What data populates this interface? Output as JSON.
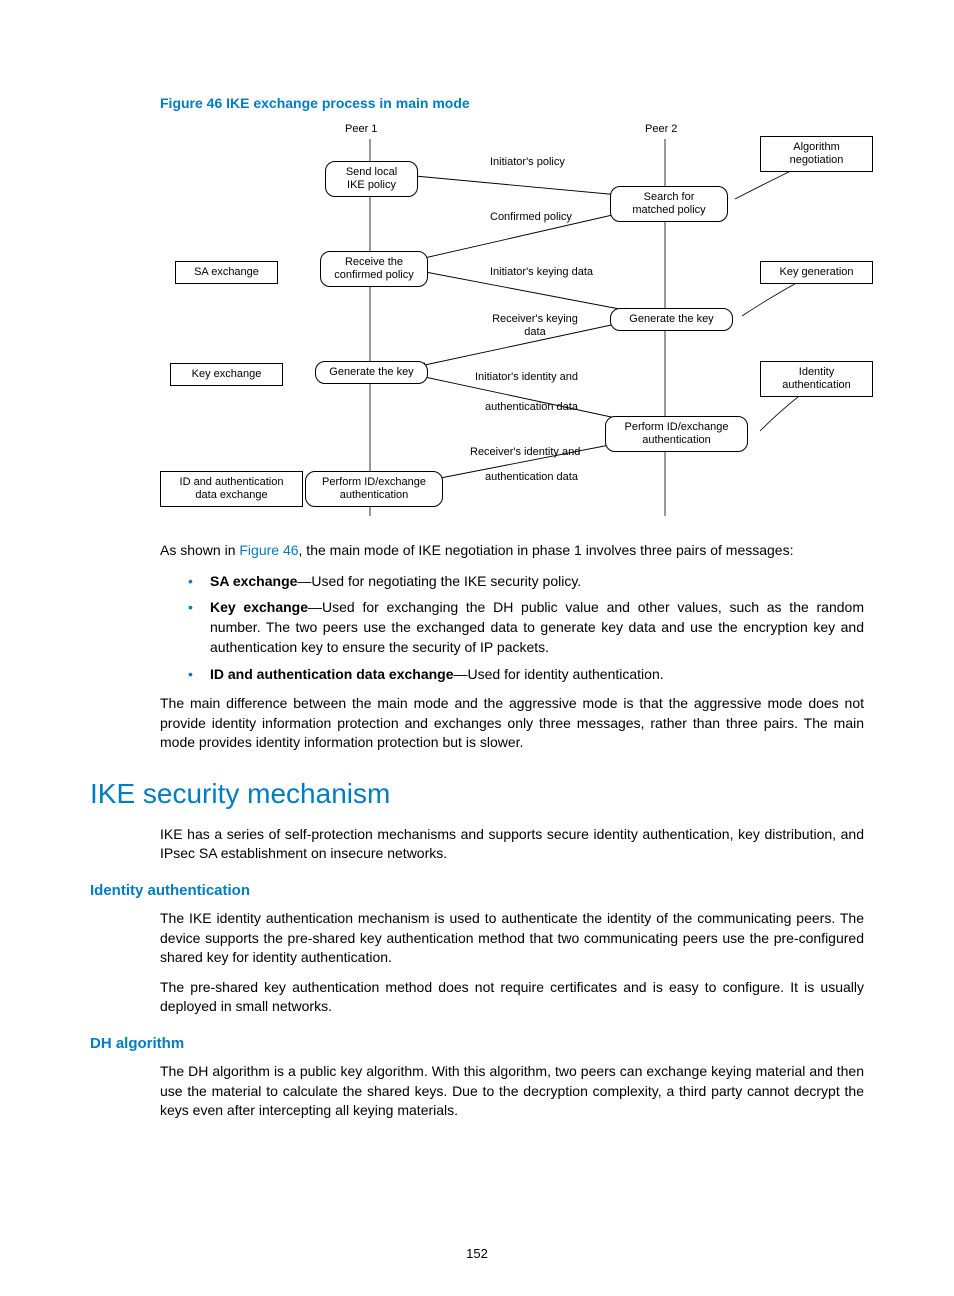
{
  "figCaption": "Figure 46 IKE exchange process in main mode",
  "diagram": {
    "peer1": "Peer 1",
    "peer2": "Peer 2",
    "algNeg": "Algorithm\nnegotiation",
    "keyGen": "Key generation",
    "idAuth": "Identity\nauthentication",
    "saExchange": "SA exchange",
    "keyExchange": "Key exchange",
    "idDataExchange": "ID and authentication\ndata exchange",
    "sendLocal": "Send local\nIKE policy",
    "searchMatched": "Search for\nmatched policy",
    "receiveConfirmed": "Receive the\nconfirmed policy",
    "genKeyRight": "Generate the key",
    "genKeyLeft": "Generate the key",
    "performRight": "Perform ID/exchange\nauthentication",
    "performLeft": "Perform ID/exchange\nauthentication",
    "initiatorPolicy": "Initiator's policy",
    "confirmedPolicy": "Confirmed policy",
    "initiatorKeying": "Initiator's keying data",
    "receiverKeying": "Receiver's keying\ndata",
    "initiatorIdentity": "Initiator's identity and",
    "authData1": "authentication data",
    "receiverIdentity": "Receiver's identity and",
    "authData2": "authentication data"
  },
  "intro": {
    "prefix": "As shown in ",
    "link": "Figure 46",
    "suffix": ", the main mode of IKE negotiation in phase 1 involves three pairs of messages:"
  },
  "bullets": [
    {
      "bold": "SA exchange",
      "text": "—Used for negotiating the IKE security policy."
    },
    {
      "bold": "Key exchange",
      "text": "—Used for exchanging the DH public value and other values, such as the random number. The two peers use the exchanged data to generate key data and use the encryption key and authentication key to ensure the security of IP packets."
    },
    {
      "bold": "ID and authentication data exchange",
      "text": "—Used for identity authentication."
    }
  ],
  "mainDiff": "The main difference between the main mode and the aggressive mode is that the aggressive mode does not provide identity information protection and exchanges only three messages, rather than three pairs. The main mode provides identity information protection but is slower.",
  "h1": "IKE security mechanism",
  "ikeIntro": "IKE has a series of self-protection mechanisms and supports secure identity authentication, key distribution, and IPsec SA establishment on insecure networks.",
  "sub1": "Identity authentication",
  "sub1p1": "The IKE identity authentication mechanism is used to authenticate the identity of the communicating peers. The device supports the pre-shared key authentication method that two communicating peers use the pre-configured shared key for identity authentication.",
  "sub1p2": "The pre-shared key authentication method does not require certificates and is easy to configure. It is usually deployed in small networks.",
  "sub2": "DH algorithm",
  "sub2p1": "The DH algorithm is a public key algorithm. With this algorithm, two peers can exchange keying material and then use the material to calculate the shared keys. Due to the decryption complexity, a third party cannot decrypt the keys even after intercepting all keying materials.",
  "pageNum": "152"
}
